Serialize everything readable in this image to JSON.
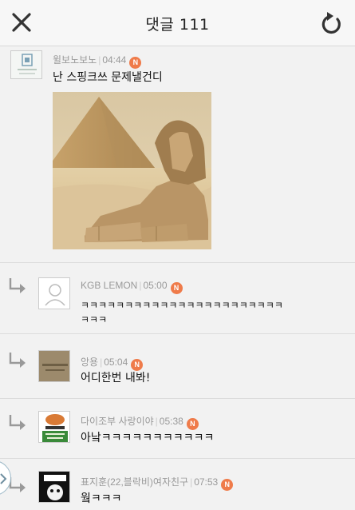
{
  "header": {
    "title": "댓글 111"
  },
  "comments": [
    {
      "author": "윌보노보노",
      "time": "04:44",
      "badge": "N",
      "text": "난 스핑크쓰 문제낼건디"
    },
    {
      "author": "KGB LEMON",
      "time": "05:00",
      "badge": "N",
      "text_line1": "ㅋㅋㅋㅋㅋㅋㅋㅋㅋㅋㅋㅋㅋㅋㅋㅋㅋㅋㅋㅋㅋㅋㅋ",
      "text_line2": "ㅋㅋㅋ"
    },
    {
      "author": "앙용",
      "time": "05:04",
      "badge": "N",
      "text": "어디한번 내봐!"
    },
    {
      "author": "다이조부 사랑이야",
      "time": "05:38",
      "badge": "N",
      "text": "아낰ㅋㅋㅋㅋㅋㅋㅋㅋㅋㅋㅋ"
    },
    {
      "author": "표지훈(22,블락비)여자친구",
      "time": "07:53",
      "badge": "N",
      "text": "웤ㅋㅋㅋ"
    }
  ],
  "colors": {
    "accent": "#ef7b4a",
    "background": "#f2f2f2"
  },
  "icons": [
    "close-icon",
    "refresh-icon",
    "reply-arrow-icon",
    "new-badge-icon"
  ]
}
